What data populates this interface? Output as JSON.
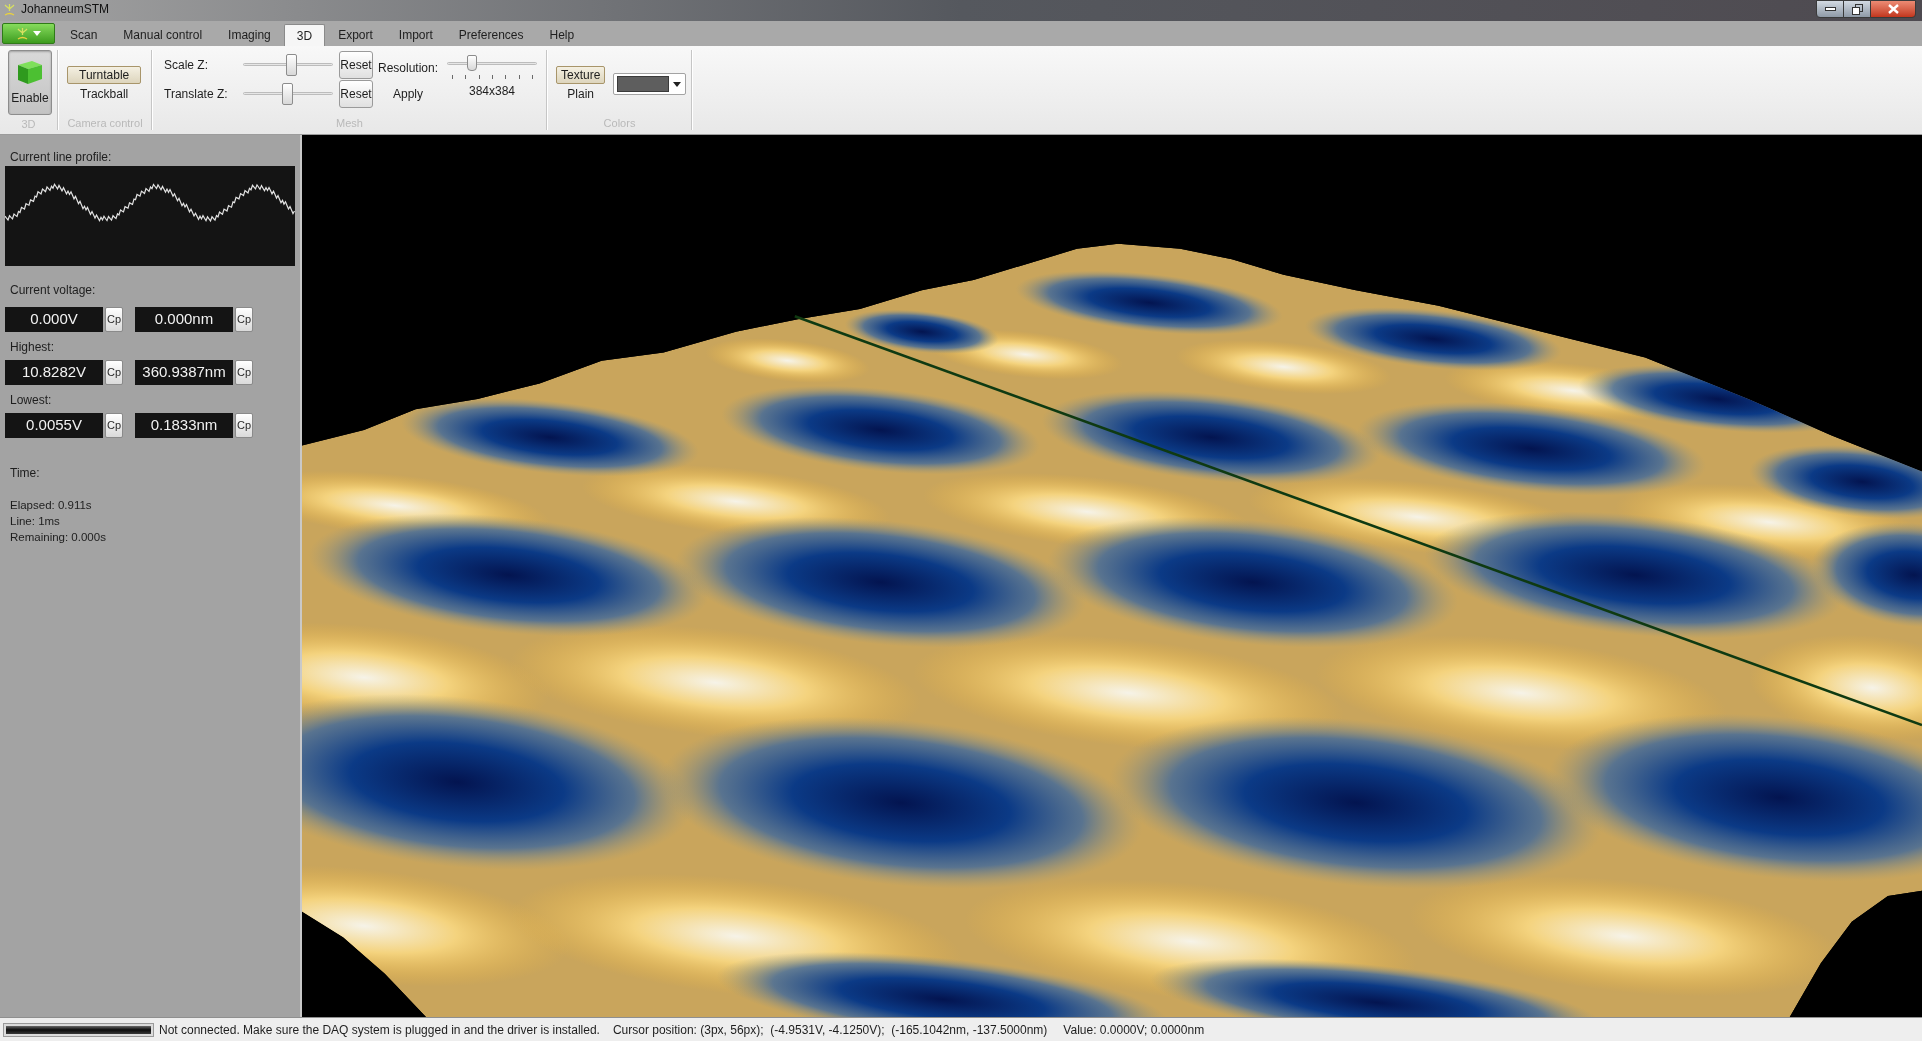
{
  "window": {
    "title": "JohanneumSTM"
  },
  "tabs": [
    {
      "label": "Scan",
      "selected": false
    },
    {
      "label": "Manual control",
      "selected": false
    },
    {
      "label": "Imaging",
      "selected": false
    },
    {
      "label": "3D",
      "selected": true
    },
    {
      "label": "Export",
      "selected": false
    },
    {
      "label": "Import",
      "selected": false
    },
    {
      "label": "Preferences",
      "selected": false
    },
    {
      "label": "Help",
      "selected": false
    }
  ],
  "ribbon": {
    "groups": [
      {
        "kind": "button",
        "label": "3D",
        "button": {
          "label": "Enable",
          "pressed": true
        }
      },
      {
        "kind": "choice",
        "label": "Camera control",
        "options": [
          {
            "label": "Turntable",
            "selected": true
          },
          {
            "label": "Trackball",
            "selected": false
          }
        ]
      },
      {
        "kind": "mesh",
        "label": "Mesh",
        "sliders": [
          {
            "label": "Scale Z:",
            "level": 0.55,
            "button": "Reset"
          },
          {
            "label": "Translate Z:",
            "level": 0.49,
            "button": "Reset"
          }
        ],
        "resolution": {
          "label": "Resolution:",
          "level": 0.25,
          "value": "384x384",
          "button": "Apply"
        }
      },
      {
        "kind": "choice",
        "label": "Colors",
        "options": [
          {
            "label": "Texture",
            "selected": true
          },
          {
            "label": "Plain",
            "selected": false
          }
        ],
        "color_picker": {
          "color": "#5e5e5e"
        }
      }
    ]
  },
  "side_panel": {
    "profile_label": "Current line profile:",
    "readouts": [
      {
        "label": "Current voltage:",
        "fields": [
          {
            "value": "0.000V",
            "button": "Cp"
          },
          {
            "value": "0.000nm",
            "button": "Cp"
          }
        ]
      },
      {
        "label": "Highest:",
        "fields": [
          {
            "value": "10.8282V",
            "button": "Cp"
          },
          {
            "value": "360.9387nm",
            "button": "Cp"
          }
        ]
      },
      {
        "label": "Lowest:",
        "fields": [
          {
            "value": "0.0055V",
            "button": "Cp"
          },
          {
            "value": "0.1833nm",
            "button": "Cp"
          }
        ]
      }
    ],
    "time": {
      "label": "Time:",
      "lines": [
        "Elapsed: 0.911s",
        "Line: 1ms",
        "Remaining: 0.000s"
      ]
    }
  },
  "status_bar": {
    "progress": {
      "level": 1
    },
    "message": "Not connected. Make sure the DAQ system is plugged in and the driver is installed.",
    "cursor": "Cursor position: (3px, 56px);  (-4.9531V, -4.1250V);  (-165.1042nm, -137.5000nm)",
    "value": "Value: 0.0000V; 0.0000nm"
  }
}
